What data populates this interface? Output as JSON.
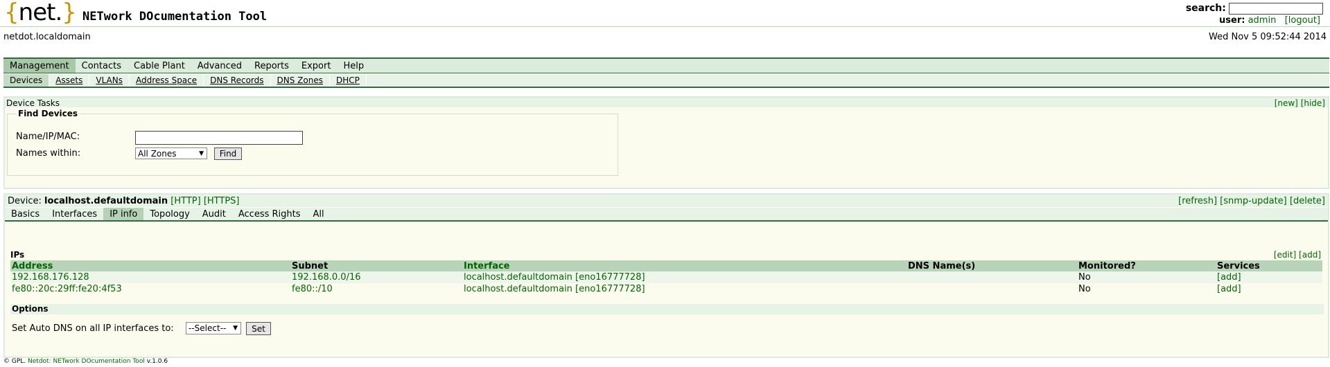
{
  "header": {
    "logo_open": "{",
    "logo_word": "net.",
    "logo_close": "}",
    "app_title": "NETwork DOcumentation Tool",
    "search_label": "search:",
    "search_value": "",
    "user_label": "user:",
    "user_name": "admin",
    "logout_label": "[logout]",
    "hostname": "netdot.localdomain",
    "datetime": "Wed Nov 5 09:52:44 2014"
  },
  "main_nav": {
    "items": [
      "Management",
      "Contacts",
      "Cable Plant",
      "Advanced",
      "Reports",
      "Export",
      "Help"
    ],
    "active": "Management"
  },
  "sub_nav": {
    "items": [
      "Devices",
      "Assets",
      "VLANs",
      "Address Space",
      "DNS Records",
      "DNS Zones",
      "DHCP"
    ],
    "active": "Devices"
  },
  "tasks": {
    "title": "Device Tasks",
    "new_label": "[new]",
    "hide_label": "[hide]",
    "fieldset_legend": "Find Devices",
    "name_label": "Name/IP/MAC:",
    "name_value": "",
    "zone_label": "Names within:",
    "zone_selected": "All Zones",
    "find_label": "Find"
  },
  "device": {
    "label": "Device:",
    "name": "localhost.defaultdomain",
    "http_link": "[HTTP]",
    "https_link": "[HTTPS]",
    "refresh_label": "[refresh]",
    "snmp_update_label": "[snmp-update]",
    "delete_label": "[delete]",
    "tabs": [
      "Basics",
      "Interfaces",
      "IP info",
      "Topology",
      "Audit",
      "Access Rights",
      "All"
    ],
    "active_tab": "IP info"
  },
  "ips": {
    "title": "IPs",
    "edit_label": "[edit]",
    "add_label": "[add]",
    "columns": [
      "Address",
      "Subnet",
      "Interface",
      "DNS Name(s)",
      "Monitored?",
      "Services"
    ],
    "rows": [
      {
        "address": "192.168.176.128",
        "subnet": "192.168.0.0/16",
        "interface": "localhost.defaultdomain [eno16777728]",
        "dns": "",
        "monitored": "No",
        "services": "[add]"
      },
      {
        "address": "fe80::20c:29ff:fe20:4f53",
        "subnet": "fe80::/10",
        "interface": "localhost.defaultdomain [eno16777728]",
        "dns": "",
        "monitored": "No",
        "services": "[add]"
      }
    ]
  },
  "options": {
    "title": "Options",
    "autodns_label": "Set Auto DNS on all IP interfaces to:",
    "autodns_selected": "--Select--",
    "set_label": "Set"
  },
  "footer": {
    "prefix": "© GPL.",
    "link": "Netdot: NETwork DOcumentation Tool",
    "version": "v.1.0.6"
  },
  "colors": {
    "link_green": "#006600",
    "nav_bg": "#dcecdc",
    "nav_active": "#a8c8a8",
    "table_header": "#b8d4b8",
    "panel_bg": "#fbfbee",
    "logo_brace": "#c89400"
  }
}
